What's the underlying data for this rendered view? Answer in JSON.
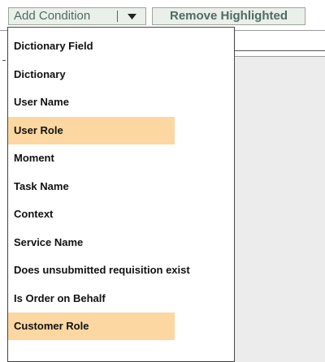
{
  "toolbar": {
    "add_condition_label": "Add Condition",
    "remove_highlighted_label": "Remove Highlighted"
  },
  "menu": {
    "items": [
      {
        "label": "Dictionary Field",
        "highlighted": false
      },
      {
        "label": "Dictionary",
        "highlighted": false
      },
      {
        "label": "User Name",
        "highlighted": false
      },
      {
        "label": "User Role",
        "highlighted": true
      },
      {
        "label": "Moment",
        "highlighted": false
      },
      {
        "label": "Task Name",
        "highlighted": false
      },
      {
        "label": "Context",
        "highlighted": false
      },
      {
        "label": "Service Name",
        "highlighted": false
      },
      {
        "label": "Does unsubmitted requisition exist",
        "highlighted": false
      },
      {
        "label": "Is Order on Behalf",
        "highlighted": false
      },
      {
        "label": "Customer Role",
        "highlighted": true
      }
    ]
  },
  "colors": {
    "highlight": "#fcd7a1",
    "button_bg": "#eaefe9",
    "button_text": "#4e6a66"
  },
  "icons": {
    "dropdown_arrow": "triangle-down-icon"
  }
}
